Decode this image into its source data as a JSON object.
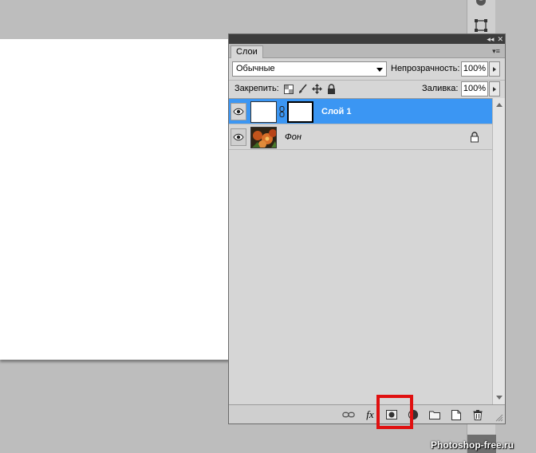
{
  "panel": {
    "tab_label": "Слои",
    "titlebar_collapse": "◂◂",
    "titlebar_close": "✕",
    "menu_glyph": "▾≡"
  },
  "blend": {
    "mode": "Обычные",
    "opacity_label": "Непрозрачность:",
    "opacity_value": "100%"
  },
  "lock": {
    "label": "Закрепить:",
    "fill_label": "Заливка:",
    "fill_value": "100%"
  },
  "layers": [
    {
      "name": "Слой 1",
      "selected": true,
      "has_mask": true
    },
    {
      "name": "Фон",
      "selected": false,
      "locked": true
    }
  ],
  "bottom_bar": {
    "icons": [
      "link-layers-icon",
      "fx-icon",
      "add-mask-icon",
      "adjustment-layer-icon",
      "new-group-icon",
      "new-layer-icon",
      "trash-icon"
    ],
    "fx_text": "fx"
  },
  "watermark": "Photoshop-free.ru",
  "colors": {
    "selection": "#3b96f3",
    "highlight": "#e01010"
  }
}
